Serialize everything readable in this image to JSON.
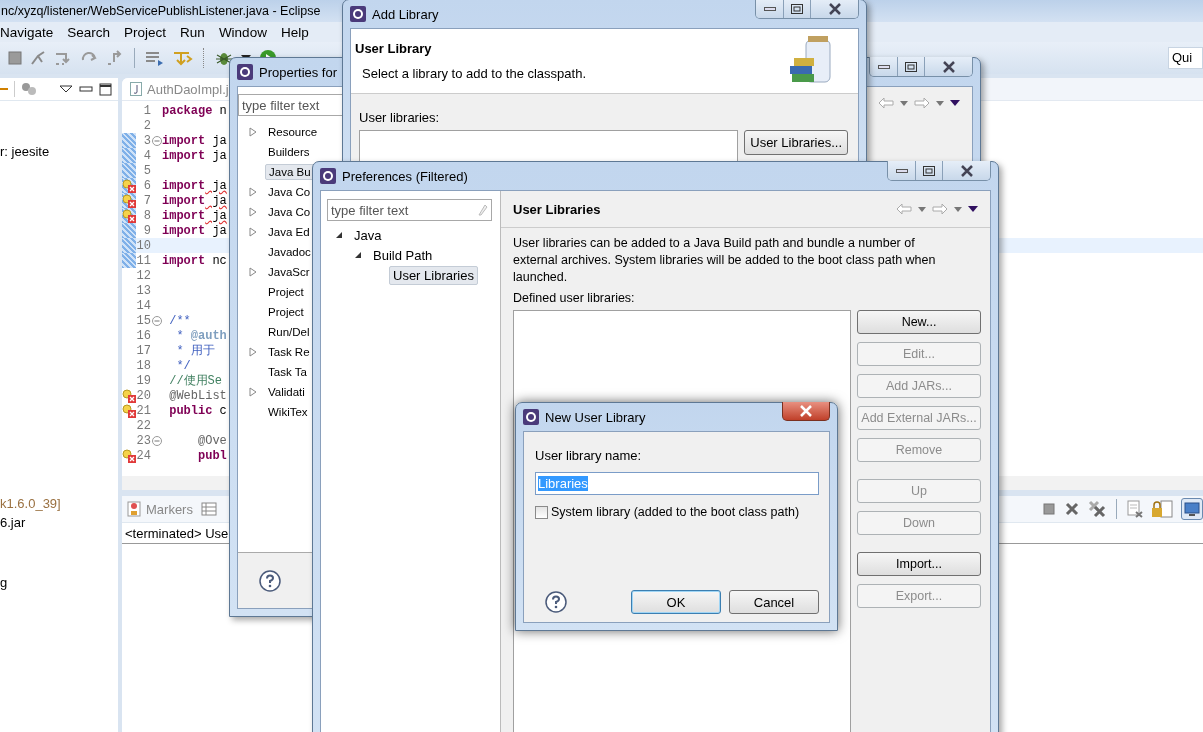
{
  "eclipse": {
    "title": "nc/xyzq/listener/WebServicePublishListener.java - Eclipse",
    "menu": [
      "Navigate",
      "Search",
      "Project",
      "Run",
      "Window",
      "Help"
    ],
    "quick_access": "Qui",
    "left_panel": {
      "lines": [
        {
          "text": "r: jeesite",
          "muted": false
        },
        {
          "text": "k1.6.0_39]",
          "muted": true
        },
        {
          "text": "6.jar",
          "muted": false
        },
        {
          "text": "g",
          "muted": false
        }
      ]
    },
    "editor": {
      "tab": "AuthDaoImpl.j",
      "lines": [
        {
          "number": "1",
          "changed": false,
          "fold": false,
          "error": false,
          "current": false,
          "parts": [
            {
              "text": "package",
              "kind": "keyword"
            },
            {
              "text": " n",
              "kind": "plain"
            }
          ]
        },
        {
          "number": "2",
          "changed": false,
          "fold": false,
          "error": false,
          "current": false
        },
        {
          "number": "3",
          "changed": true,
          "fold": true,
          "error": false,
          "current": false,
          "parts": [
            {
              "text": "import",
              "kind": "keyword"
            },
            {
              "text": " ja",
              "kind": "plain"
            }
          ]
        },
        {
          "number": "4",
          "changed": true,
          "fold": false,
          "error": false,
          "current": false,
          "parts": [
            {
              "text": "import",
              "kind": "keyword"
            },
            {
              "text": " ja",
              "kind": "plain"
            }
          ]
        },
        {
          "number": "5",
          "changed": true,
          "fold": false,
          "error": false,
          "current": false
        },
        {
          "number": "6",
          "changed": true,
          "fold": false,
          "error": true,
          "current": false,
          "parts": [
            {
              "text": "import",
              "kind": "keyword"
            },
            {
              "text": " ja",
              "kind": "error"
            }
          ]
        },
        {
          "number": "7",
          "changed": true,
          "fold": false,
          "error": true,
          "current": false,
          "parts": [
            {
              "text": "import",
              "kind": "keyword"
            },
            {
              "text": " ja",
              "kind": "error"
            }
          ]
        },
        {
          "number": "8",
          "changed": true,
          "fold": false,
          "error": true,
          "current": false,
          "parts": [
            {
              "text": "import",
              "kind": "keyword"
            },
            {
              "text": " ja",
              "kind": "error"
            }
          ]
        },
        {
          "number": "9",
          "changed": true,
          "fold": false,
          "error": false,
          "current": false,
          "parts": [
            {
              "text": "import",
              "kind": "keyword"
            },
            {
              "text": " ja",
              "kind": "plain"
            }
          ]
        },
        {
          "number": "10",
          "changed": true,
          "fold": false,
          "error": false,
          "current": true
        },
        {
          "number": "11",
          "changed": true,
          "fold": false,
          "error": false,
          "current": false,
          "parts": [
            {
              "text": "import",
              "kind": "keyword"
            },
            {
              "text": " nc",
              "kind": "plain"
            }
          ]
        },
        {
          "number": "12",
          "changed": false,
          "fold": false,
          "error": false,
          "current": false
        },
        {
          "number": "13",
          "changed": false,
          "fold": false,
          "error": false,
          "current": false
        },
        {
          "number": "14",
          "changed": false,
          "fold": false,
          "error": false,
          "current": false
        },
        {
          "number": "15",
          "changed": false,
          "fold": true,
          "error": false,
          "current": false,
          "parts": [
            {
              "text": " /**",
              "kind": "javadoc"
            }
          ]
        },
        {
          "number": "16",
          "changed": false,
          "fold": false,
          "error": false,
          "current": false,
          "parts": [
            {
              "text": "  * ",
              "kind": "javadoc"
            },
            {
              "text": "@auth",
              "kind": "doctag"
            }
          ]
        },
        {
          "number": "17",
          "changed": false,
          "fold": false,
          "error": false,
          "current": false,
          "parts": [
            {
              "text": "  * 用于",
              "kind": "javadoc"
            }
          ]
        },
        {
          "number": "18",
          "changed": false,
          "fold": false,
          "error": false,
          "current": false,
          "parts": [
            {
              "text": "  */",
              "kind": "javadoc"
            }
          ]
        },
        {
          "number": "19",
          "changed": false,
          "fold": false,
          "error": false,
          "current": false,
          "parts": [
            {
              "text": " //使用Se",
              "kind": "comment"
            }
          ]
        },
        {
          "number": "20",
          "changed": false,
          "fold": false,
          "error": true,
          "current": false,
          "parts": [
            {
              "text": " @WebList",
              "kind": "annotation"
            }
          ]
        },
        {
          "number": "21",
          "changed": false,
          "fold": false,
          "error": true,
          "current": false,
          "parts": [
            {
              "text": " public",
              "kind": "keyword"
            },
            {
              "text": " c",
              "kind": "plain"
            }
          ]
        },
        {
          "number": "22",
          "changed": false,
          "fold": false,
          "error": false,
          "current": false
        },
        {
          "number": "23",
          "changed": false,
          "fold": true,
          "error": false,
          "current": false,
          "parts": [
            {
              "text": "     @Ove",
              "kind": "annotation"
            }
          ]
        },
        {
          "number": "24",
          "changed": false,
          "fold": false,
          "error": true,
          "current": false,
          "parts": [
            {
              "text": "     publ",
              "kind": "keyword"
            }
          ]
        }
      ]
    },
    "bottom_panel": {
      "tab": "Markers",
      "console": "<terminated> Use"
    }
  },
  "properties": {
    "title": "Properties for",
    "filter_placeholder": "type filter text",
    "tree": [
      {
        "label": "Resource",
        "expandable": true,
        "selected": false
      },
      {
        "label": "Builders",
        "expandable": false,
        "selected": false
      },
      {
        "label": "Java Bu",
        "expandable": false,
        "selected": true
      },
      {
        "label": "Java Co",
        "expandable": true,
        "selected": false
      },
      {
        "label": "Java Co",
        "expandable": true,
        "selected": false
      },
      {
        "label": "Java Ed",
        "expandable": true,
        "selected": false
      },
      {
        "label": "Javadoc",
        "expandable": false,
        "selected": false
      },
      {
        "label": "JavaScr",
        "expandable": true,
        "selected": false
      },
      {
        "label": "Project",
        "expandable": false,
        "selected": false
      },
      {
        "label": "Project",
        "expandable": false,
        "selected": false
      },
      {
        "label": "Run/Del",
        "expandable": false,
        "selected": false
      },
      {
        "label": "Task Re",
        "expandable": true,
        "selected": false
      },
      {
        "label": "Task Ta",
        "expandable": false,
        "selected": false
      },
      {
        "label": "Validati",
        "expandable": true,
        "selected": false
      },
      {
        "label": "WikiTex",
        "expandable": false,
        "selected": false
      }
    ]
  },
  "add_library": {
    "title": "Add Library",
    "heading": "User Library",
    "description": "Select a library to add to the classpath.",
    "list_label": "User libraries:",
    "button": "User Libraries..."
  },
  "preferences": {
    "title": "Preferences (Filtered)",
    "filter_placeholder": "type filter text",
    "tree": [
      {
        "label": "Java",
        "expanded": true,
        "selected": false,
        "children": [
          {
            "label": "Build Path",
            "expanded": true,
            "selected": false,
            "children": [
              {
                "label": "User Libraries",
                "selected": true
              }
            ]
          }
        ]
      }
    ],
    "heading": "User Libraries",
    "description": "User libraries can be added to a Java Build path and bundle a number of external archives. System libraries will be added to the boot class path when launched.",
    "list_label": "Defined user libraries:",
    "button_groups": [
      [
        {
          "label": "New...",
          "disabled": false
        },
        {
          "label": "Edit...",
          "disabled": true
        },
        {
          "label": "Add JARs...",
          "disabled": true
        },
        {
          "label": "Add External JARs...",
          "disabled": true
        },
        {
          "label": "Remove",
          "disabled": true
        }
      ],
      [
        {
          "label": "Up",
          "disabled": true
        },
        {
          "label": "Down",
          "disabled": true
        }
      ],
      [
        {
          "label": "Import...",
          "disabled": false
        },
        {
          "label": "Export...",
          "disabled": true
        }
      ]
    ]
  },
  "new_user_library": {
    "title": "New User Library",
    "name_label": "User library name:",
    "name_value": "Libraries",
    "value_selected": true,
    "system_checkbox": {
      "label": "System library (added to the boot class path)",
      "checked": false
    },
    "buttons": [
      {
        "label": "OK",
        "default": true
      },
      {
        "label": "Cancel",
        "default": false
      }
    ]
  }
}
